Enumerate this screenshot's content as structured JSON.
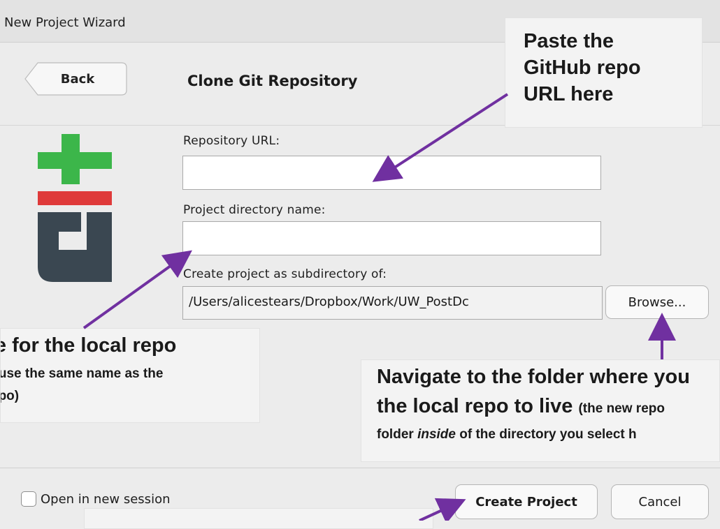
{
  "window": {
    "title": "New Project Wizard"
  },
  "header": {
    "back_label": "Back",
    "heading": "Clone Git Repository"
  },
  "form": {
    "repo_url_label": "Repository URL:",
    "repo_url_value": "",
    "project_dir_label": "Project directory name:",
    "project_dir_value": "",
    "subdir_label": "Create project as subdirectory of:",
    "subdir_value": "/Users/alicestears/Dropbox/Work/UW_PostDc",
    "browse_label": "Browse..."
  },
  "footer": {
    "open_new_session_label": "Open in new session",
    "open_new_session_checked": false,
    "create_label": "Create Project",
    "cancel_label": "Cancel"
  },
  "annotations": {
    "repo_url": {
      "line1": "Paste the",
      "line2": "GitHub repo",
      "line3": "URL here"
    },
    "dir_name": {
      "line1": "ame for the local repo",
      "line2": "o use the same name as the",
      "line3": "epo)"
    },
    "browse": {
      "line1": "Navigate to the folder where you",
      "line2_bold": "the local repo to live ",
      "line2_small": "(the new repo",
      "line3_a": "folder ",
      "line3_italic": "inside",
      "line3_b": " of the directory you select h"
    }
  },
  "colors": {
    "arrow": "#7030a0",
    "git_green": "#3cb64a",
    "git_red": "#df3a3a",
    "git_gray": "#3a4751"
  },
  "icons": {
    "logo": "git-logo"
  }
}
